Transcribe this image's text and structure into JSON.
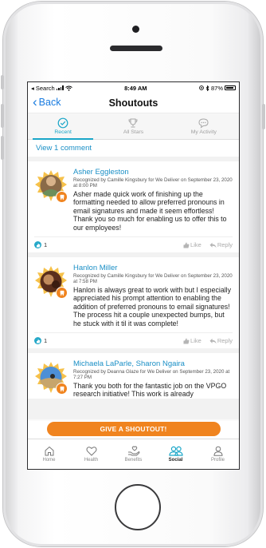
{
  "status": {
    "carrier": "◂ Search",
    "time": "8:49 AM",
    "battery": "87%"
  },
  "nav": {
    "back_label": "Back",
    "title": "Shoutouts"
  },
  "tabs": [
    {
      "label": "Recent",
      "icon": "check-circle-icon",
      "active": true
    },
    {
      "label": "All Stars",
      "icon": "trophy-icon",
      "active": false
    },
    {
      "label": "My Activity",
      "icon": "chat-bubble-icon",
      "active": false
    }
  ],
  "feed": {
    "view_comments": "View 1 comment",
    "posts": [
      {
        "name": "Asher Eggleston",
        "meta": "Recognized by Camille Kingsbury for We Deliver on September 23, 2020 at 8:00 PM",
        "text": "Asher made quick work of finishing up the formatting needed to allow preferred pronouns in email signatures and made it seem effortless! Thank you so much for enabling us to offer this to our employees!",
        "likes": "1",
        "like_label": "Like",
        "reply_label": "Reply"
      },
      {
        "name": "Hanlon Miller",
        "meta": "Recognized by Camille Kingsbury for We Deliver on September 23, 2020 at 7:58 PM",
        "text": "Hanlon is always great to work with but I especially appreciated his prompt attention to enabling the addition of preferred pronouns to email signatures! The process hit a couple unexpected bumps, but he stuck with it til it was complete!",
        "likes": "1",
        "like_label": "Like",
        "reply_label": "Reply"
      },
      {
        "name": "Michaela LaParle, Sharon Ngaira",
        "meta": "Recognized by Deanna Glaze for We Deliver on September 23, 2020 at 7:27 PM",
        "text": "Thank you both for the fantastic job on the VPGO research initiative! This work is already"
      }
    ]
  },
  "cta": {
    "label": "GIVE A SHOUTOUT!"
  },
  "tab_bar": [
    {
      "label": "Home",
      "icon": "home-icon",
      "active": false
    },
    {
      "label": "Health",
      "icon": "heart-icon",
      "active": false
    },
    {
      "label": "Benefits",
      "icon": "benefits-hand-icon",
      "active": false
    },
    {
      "label": "Social",
      "icon": "people-icon",
      "active": true
    },
    {
      "label": "Profile",
      "icon": "person-icon",
      "active": false
    }
  ],
  "colors": {
    "accent": "#1aa6c8",
    "link": "#1a8fc6",
    "brand_orange": "#f0841f",
    "ios_blue": "#1a7ce0"
  }
}
